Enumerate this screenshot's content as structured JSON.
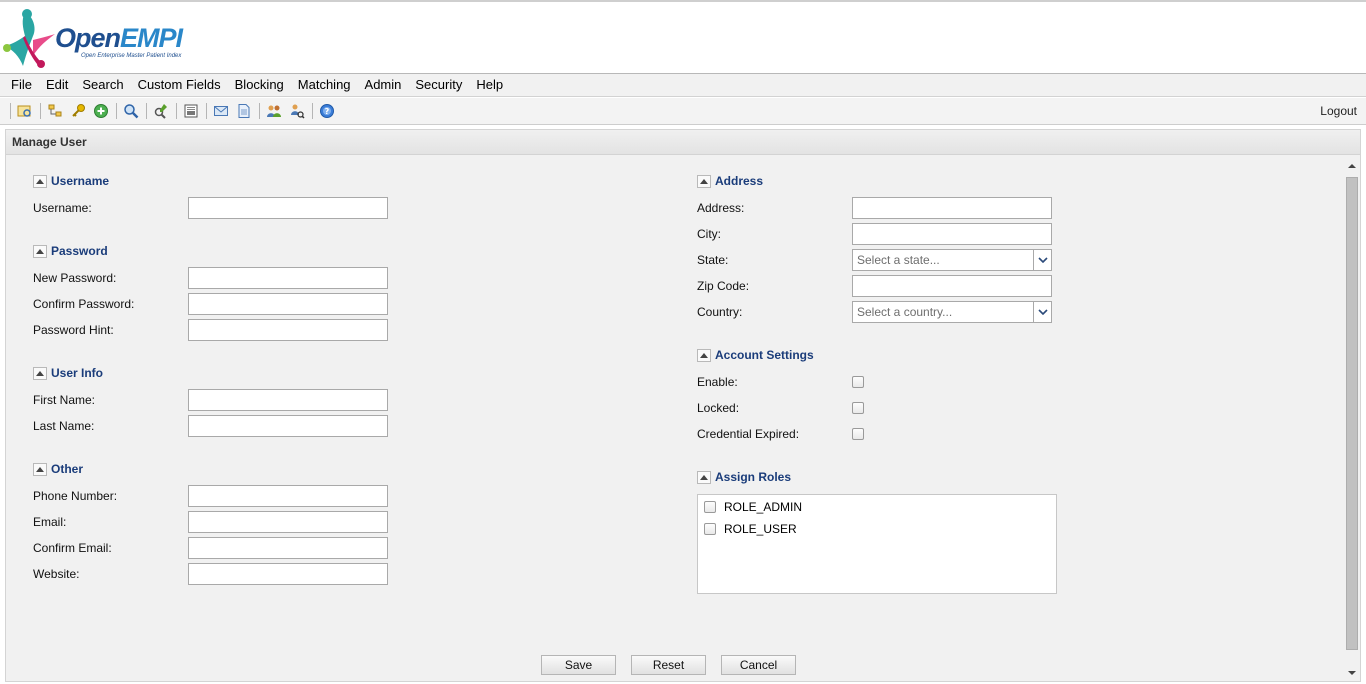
{
  "app": {
    "logo_main_1": "Open",
    "logo_main_2": "EMPI",
    "logo_tagline": "Open Enterprise Master Patient Index"
  },
  "menubar": {
    "items": [
      "File",
      "Edit",
      "Search",
      "Custom Fields",
      "Blocking",
      "Matching",
      "Admin",
      "Security",
      "Help"
    ]
  },
  "toolbar": {
    "icons": [
      "search-view-icon",
      "hierarchy-icon",
      "key-icon",
      "add-circle-icon",
      "magnifier-icon",
      "find-edit-icon",
      "report-icon",
      "mail-icon",
      "document-icon",
      "users-icon",
      "user-search-icon",
      "help-icon"
    ],
    "logout_label": "Logout"
  },
  "panel": {
    "title": "Manage User"
  },
  "sections": {
    "username": {
      "title": "Username",
      "fields": {
        "username": "Username:"
      }
    },
    "password": {
      "title": "Password",
      "fields": {
        "new_password": "New Password:",
        "confirm_password": "Confirm Password:",
        "password_hint": "Password Hint:"
      }
    },
    "user_info": {
      "title": "User Info",
      "fields": {
        "first_name": "First Name:",
        "last_name": "Last Name:"
      }
    },
    "other": {
      "title": "Other",
      "fields": {
        "phone": "Phone Number:",
        "email": "Email:",
        "confirm_email": "Confirm Email:",
        "website": "Website:"
      }
    },
    "address": {
      "title": "Address",
      "fields": {
        "address": "Address:",
        "city": "City:",
        "state": "State:",
        "zip": "Zip Code:",
        "country": "Country:"
      },
      "state_placeholder": "Select a state...",
      "country_placeholder": "Select a country..."
    },
    "account_settings": {
      "title": "Account Settings",
      "fields": {
        "enable": "Enable:",
        "locked": "Locked:",
        "credential_expired": "Credential Expired:"
      }
    },
    "assign_roles": {
      "title": "Assign Roles",
      "roles": [
        "ROLE_ADMIN",
        "ROLE_USER"
      ]
    }
  },
  "buttons": {
    "save": "Save",
    "reset": "Reset",
    "cancel": "Cancel"
  }
}
